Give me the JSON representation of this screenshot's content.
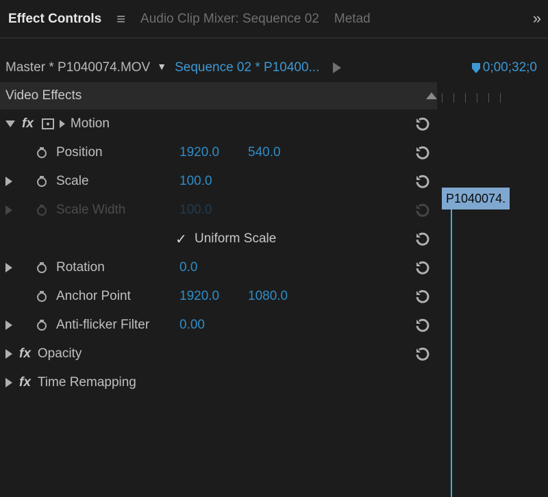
{
  "tabs": {
    "effect_controls": "Effect Controls",
    "audio_mixer": "Audio Clip Mixer: Sequence 02",
    "metadata": "Metad"
  },
  "header": {
    "master": "Master * P1040074.MOV",
    "sequence": "Sequence 02 * P10400...",
    "timecode": "0;00;32;0"
  },
  "section": {
    "video_effects": "Video Effects",
    "clip_label": "P1040074."
  },
  "motion": {
    "label": "Motion",
    "position_label": "Position",
    "position_x": "1920.0",
    "position_y": "540.0",
    "scale_label": "Scale",
    "scale_v": "100.0",
    "scale_width_label": "Scale Width",
    "scale_width_v": "100.0",
    "uniform_label": "Uniform Scale",
    "rotation_label": "Rotation",
    "rotation_v": "0.0",
    "anchor_label": "Anchor Point",
    "anchor_x": "1920.0",
    "anchor_y": "1080.0",
    "flicker_label": "Anti-flicker Filter",
    "flicker_v": "0.00"
  },
  "opacity": {
    "label": "Opacity"
  },
  "time_remap": {
    "label": "Time Remapping"
  }
}
